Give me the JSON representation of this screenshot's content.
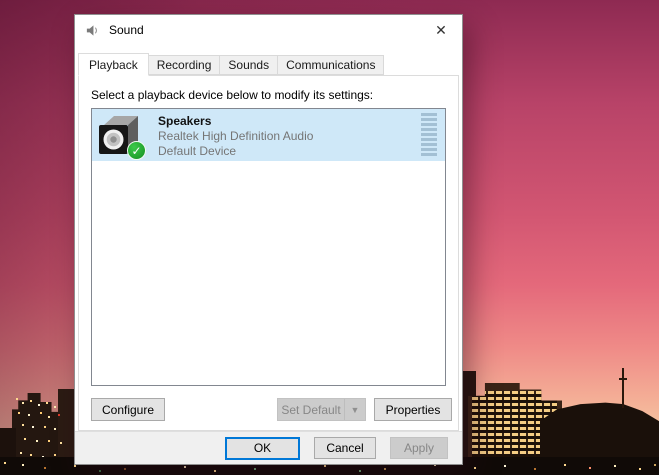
{
  "window": {
    "title": "Sound",
    "glyphs": {
      "close": "✕",
      "check": "✓",
      "dropdown": "▼"
    }
  },
  "tabs": [
    {
      "label": "Playback",
      "active": true
    },
    {
      "label": "Recording",
      "active": false
    },
    {
      "label": "Sounds",
      "active": false
    },
    {
      "label": "Communications",
      "active": false
    }
  ],
  "playback_panel": {
    "instruction": "Select a playback device below to modify its settings:",
    "devices": [
      {
        "name": "Speakers",
        "description": "Realtek High Definition Audio",
        "status": "Default Device",
        "selected": true,
        "is_default": true
      }
    ],
    "buttons": {
      "configure": "Configure",
      "set_default": "Set Default",
      "properties": "Properties"
    }
  },
  "footer_buttons": {
    "ok": "OK",
    "cancel": "Cancel",
    "apply": "Apply"
  },
  "colors": {
    "selection_highlight": "#cfe8f8",
    "focus_accent": "#0078d7",
    "default_badge_green": "#1f9e2c",
    "wallpaper_top": "#8e2a52",
    "wallpaper_bottom": "#d97f55"
  }
}
